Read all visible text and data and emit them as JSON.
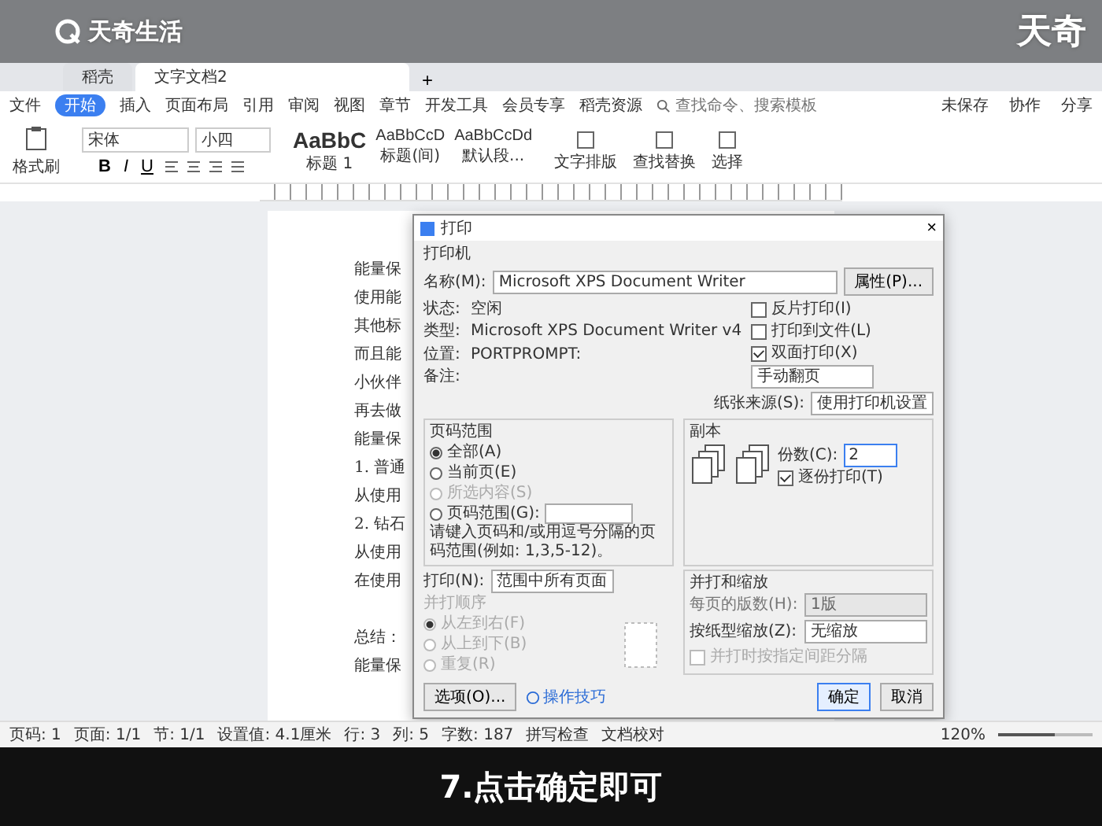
{
  "brand": {
    "name": "天奇生活",
    "corner": "天奇"
  },
  "tabs": [
    {
      "label": "稻壳",
      "selected": false
    },
    {
      "label": "文字文档2",
      "selected": true
    }
  ],
  "new_tab": "+",
  "menu": [
    {
      "label": "文件",
      "selected": false
    },
    {
      "label": "开始",
      "selected": true
    },
    {
      "label": "插入",
      "selected": false
    },
    {
      "label": "页面布局",
      "selected": false
    },
    {
      "label": "引用",
      "selected": false
    },
    {
      "label": "审阅",
      "selected": false
    },
    {
      "label": "视图",
      "selected": false
    },
    {
      "label": "章节",
      "selected": false
    },
    {
      "label": "开发工具",
      "selected": false
    },
    {
      "label": "会员专享",
      "selected": false
    },
    {
      "label": "稻壳资源",
      "selected": false
    }
  ],
  "search": {
    "placeholder": "查找命令、搜索模板"
  },
  "top_actions": [
    "未保存",
    "协作",
    "分享"
  ],
  "ribbon": {
    "painter": "格式刷",
    "font": "宋体",
    "size": "小四",
    "format_keys": [
      "B",
      "I",
      "U"
    ],
    "styles": [
      {
        "sample": "AaBbC",
        "label": "标题 1"
      },
      {
        "sample": "AaBbCcD",
        "label": "标题(间)"
      },
      {
        "sample": "AaBbCcDd",
        "label": "默认段..."
      }
    ],
    "tools": [
      "文字排版",
      "查找替换",
      "选择"
    ]
  },
  "document": {
    "paragraphs": [
      [
        "能量保",
        "使用能",
        "其他标",
        "而且能",
        "小伙伴",
        "再去做",
        "能量保",
        "1. 普通",
        "从使用",
        "2. 钻石",
        "从使用",
        "在使用"
      ],
      [
        "总结：",
        "能量保"
      ]
    ]
  },
  "dialog": {
    "title": "打印",
    "close": "×",
    "printer_label": "打印机",
    "name_label": "名称(M):",
    "printer": "Microsoft XPS Document Writer",
    "properties": "属性(P)...",
    "info": [
      {
        "label": "状态:",
        "value": "空闲"
      },
      {
        "label": "类型:",
        "value": "Microsoft XPS Document Writer v4"
      },
      {
        "label": "位置:",
        "value": "PORTPROMPT:"
      },
      {
        "label": "备注:"
      }
    ],
    "options": [
      {
        "label": "反片打印(I)",
        "checked": false
      },
      {
        "label": "打印到文件(L)",
        "checked": false
      },
      {
        "label": "双面打印(X)",
        "checked": true
      }
    ],
    "duplex": "手动翻页",
    "paper_label": "纸张来源(S):",
    "paper": "使用打印机设置",
    "range_title": "页码范围",
    "ranges": [
      {
        "label": "全部(A)",
        "selected": true,
        "disabled": false
      },
      {
        "label": "当前页(E)",
        "selected": false,
        "disabled": false
      },
      {
        "label": "所选内容(S)",
        "selected": false,
        "disabled": true
      },
      {
        "label": "页码范围(G):",
        "selected": false,
        "disabled": false
      }
    ],
    "range_hint": "请键入页码和/或用逗号分隔的页码范围(例如: 1,3,5-12)。",
    "copies_title": "副本",
    "copies_label": "份数(C):",
    "copies": "2",
    "collate": {
      "label": "逐份打印(T)",
      "checked": true
    },
    "print_label": "打印(N):",
    "print_value": "范围中所有页面",
    "order_title": "并打顺序",
    "orders": [
      {
        "label": "从左到右(F)",
        "selected": true,
        "disabled": true
      },
      {
        "label": "从上到下(B)",
        "selected": false,
        "disabled": true
      },
      {
        "label": "重复(R)",
        "selected": false,
        "disabled": true
      }
    ],
    "zoom_title": "并打和缩放",
    "zoom_rows": [
      {
        "label": "每页的版数(H):",
        "value": "1版",
        "disabled": true
      },
      {
        "label": "按纸型缩放(Z):",
        "value": "无缩放",
        "disabled": false
      }
    ],
    "zoom_check": {
      "label": "并打时按指定间距分隔",
      "checked": false,
      "disabled": true
    },
    "buttons": [
      {
        "label": "选项(O)...",
        "kind": "plain"
      },
      {
        "label": "操作技巧",
        "kind": "link"
      },
      {
        "label": "确定",
        "kind": "primary"
      },
      {
        "label": "取消",
        "kind": "plain"
      }
    ]
  },
  "status_bar": {
    "items": [
      "页码: 1",
      "页面: 1/1",
      "节: 1/1",
      "设置值: 4.1厘米",
      "行: 3",
      "列: 5",
      "字数: 187",
      "拼写检查",
      "文档校对"
    ],
    "zoom": "120%",
    "level": 0.6
  },
  "subtitle": "7.点击确定即可"
}
